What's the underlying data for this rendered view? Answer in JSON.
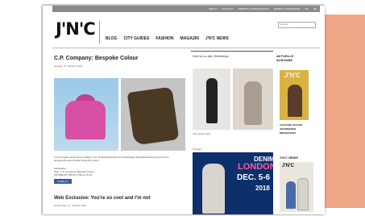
{
  "top_links": [
    "ABOUT",
    "CONTACT",
    "IMPRINT & DATENSCHUTZ",
    "TERMS & CONDITIONS",
    "EN",
    "DE"
  ],
  "logo": "J'N'C",
  "search": {
    "placeholder": "Suchen..."
  },
  "nav": [
    "BLOG",
    "CITY GUIDES",
    "FASHION",
    "MAGAZIN",
    "J'N'C NEWS"
  ],
  "article1": {
    "title": "C.P. Company: Bespoke Colour",
    "date": "Montag, 15. Oktober 2018"
  },
  "article2": {
    "title": "Web Exclusive: You're so cool and I'm not",
    "date": "Donnerstag, 11. Oktober 2018"
  },
  "col2": {
    "heading": "Wer ist zu den Streetings",
    "caption": "The Tender Spot",
    "ad_label": "Anzeige"
  },
  "ad": {
    "denim": "DENIM",
    "city": "LONDON",
    "dates": "DEC. 5-6",
    "year": "2018"
  },
  "sidebar": {
    "heading": "AKTUELLE AUSGABE",
    "mag_logo": "J'N'C",
    "links": [
      "AUSGABE KAUFEN",
      "ABONNIEREN",
      "MEDIADATEN"
    ],
    "news_heading": "J'N'C NEWS"
  },
  "body_text": "C.P. Company steht seine Vorlage in ein Textilmittelschicht mit hochwertiges Spezifikationskonzept und den ausgezeichneten Projekt 'Bespoke Colour'.",
  "meta": [
    "Stichwörter:",
    "Tags: C.P. Company, Bespoke Colour",
    "POSTED BY PR-IN TYPE on 15.07"
  ],
  "fb_label": "Gefällt mir",
  "colors": {
    "peach": "#f0a889",
    "ad_blue": "#0d2f6b",
    "ad_pink": "#ff5aa0",
    "hoodie": "#d84fa6"
  }
}
